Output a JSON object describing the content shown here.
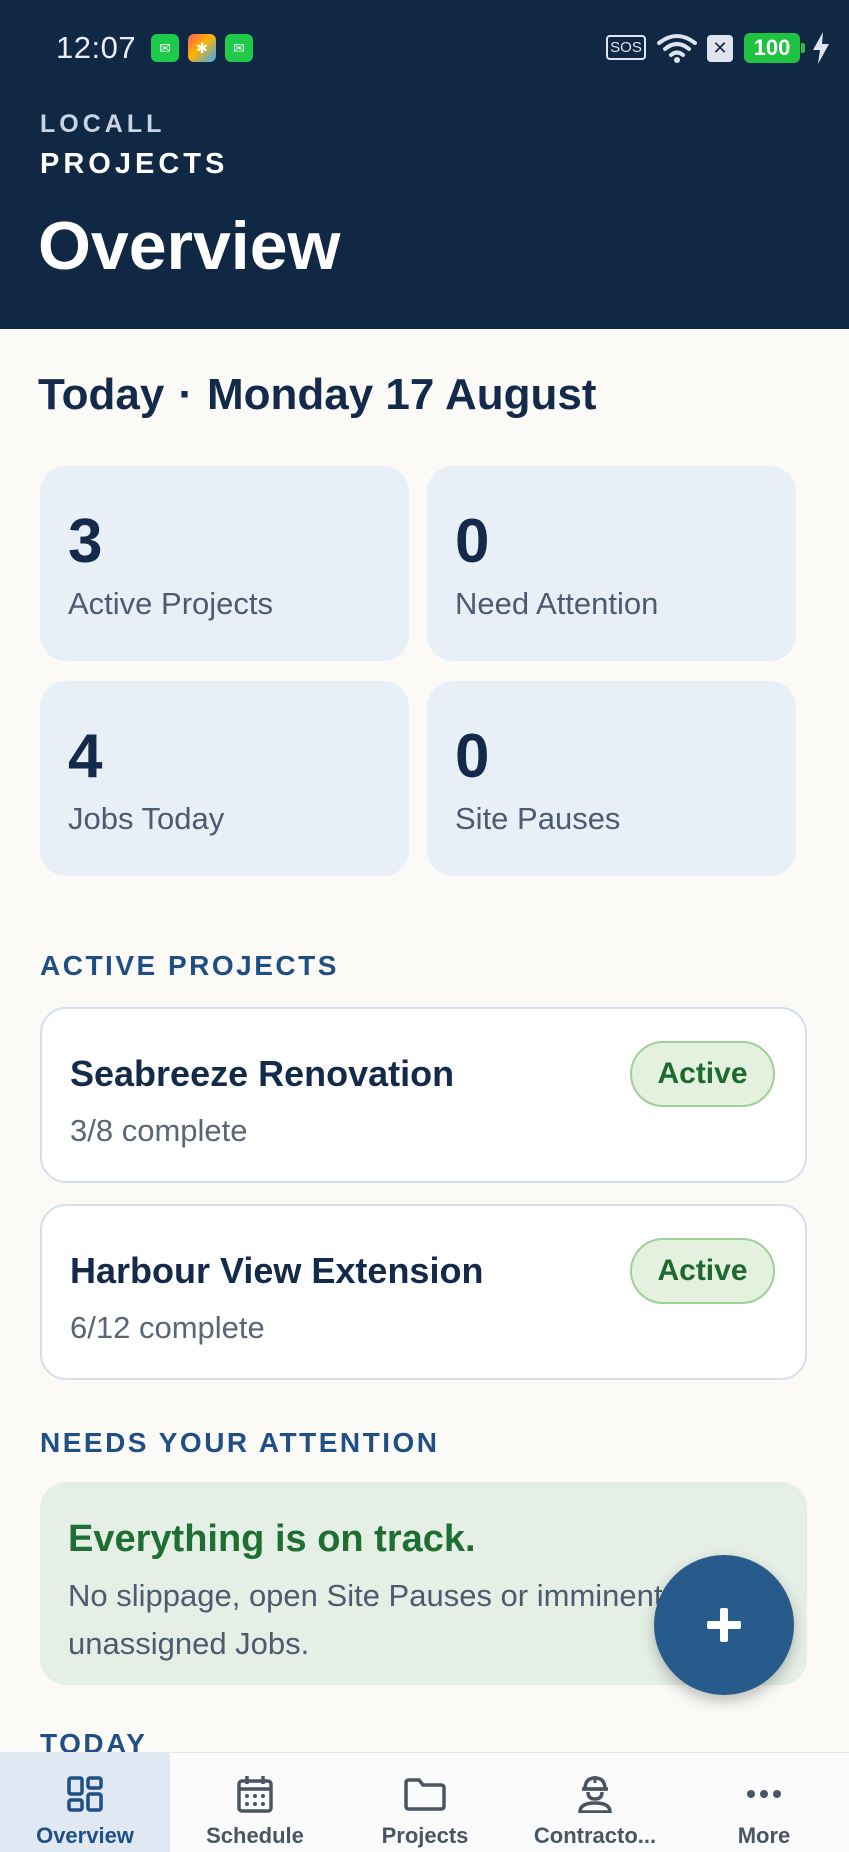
{
  "status_bar": {
    "time": "12:07",
    "sos": "SOS",
    "battery": "100",
    "colors": {
      "battery": "#20c341",
      "notif_green": "#1fc94a"
    }
  },
  "header": {
    "brand_line1": "LOCALL",
    "brand_line2": "PROJECTS",
    "title": "Overview",
    "background": "#112845"
  },
  "date": {
    "today": "Today",
    "separator": "·",
    "date_text": "Monday 17 August"
  },
  "stats": [
    {
      "value": "3",
      "label": "Active Projects"
    },
    {
      "value": "0",
      "label": "Need Attention"
    },
    {
      "value": "4",
      "label": "Jobs Today"
    },
    {
      "value": "0",
      "label": "Site Pauses"
    }
  ],
  "active_projects": {
    "heading": "ACTIVE PROJECTS",
    "items": [
      {
        "name": "Seabreeze Renovation",
        "progress": "3/8 complete",
        "status": "Active"
      },
      {
        "name": "Harbour View Extension",
        "progress": "6/12 complete",
        "status": "Active"
      }
    ]
  },
  "attention": {
    "heading": "NEEDS YOUR ATTENTION",
    "title": "Everything is on track.",
    "body": "No slippage, open Site Pauses or imminent unassigned Jobs."
  },
  "today_section": {
    "heading": "TODAY"
  },
  "fab": {
    "icon": "plus-icon"
  },
  "nav": {
    "items": [
      {
        "label": "Overview",
        "icon": "dashboard-icon",
        "active": true
      },
      {
        "label": "Schedule",
        "icon": "calendar-icon",
        "active": false
      },
      {
        "label": "Projects",
        "icon": "folder-icon",
        "active": false
      },
      {
        "label": "Contracto...",
        "icon": "worker-icon",
        "active": false
      },
      {
        "label": "More",
        "icon": "more-icon",
        "active": false
      }
    ]
  },
  "colors": {
    "accent": "#275b8c",
    "section_label": "#1f4f84",
    "active_badge": "#1e6a2e",
    "ok_title": "#1f6f34"
  }
}
